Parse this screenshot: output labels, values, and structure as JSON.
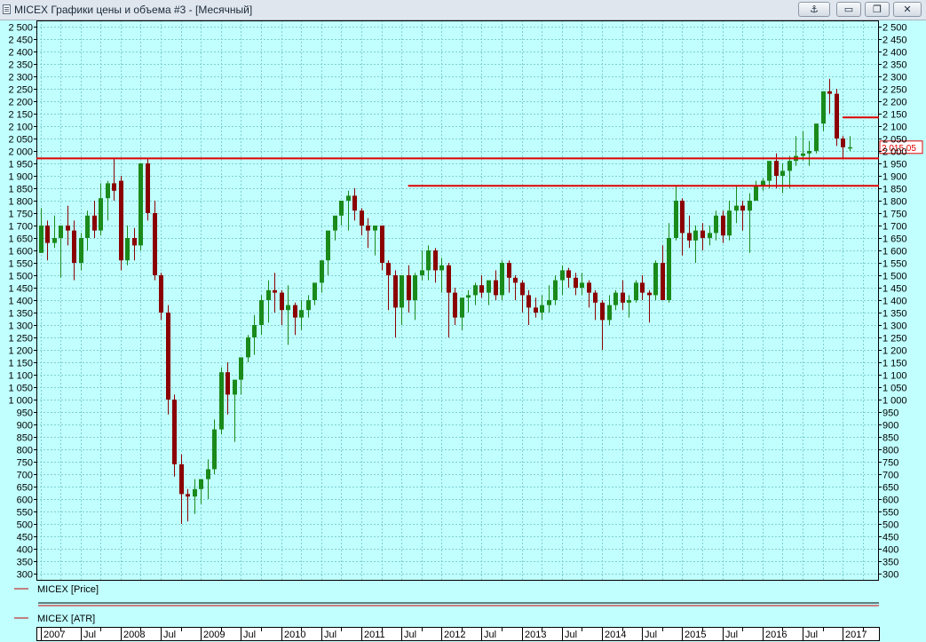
{
  "window": {
    "title": "MICEX Графики цены и объема #3 - [Месячный]",
    "icons": [
      "chart-window-icon",
      "anchor-icon",
      "minimize-icon",
      "restore-icon",
      "close-icon"
    ]
  },
  "legend": {
    "price_label": "MICEX [Price]",
    "atr_label": "MICEX [ATR]"
  },
  "colors": {
    "background": "#c1ffff",
    "grid": "#7fcfcf",
    "up_candle": "#1a8a1a",
    "down_candle": "#8b0000",
    "level_line": "#e00000",
    "axis_text": "#000000"
  },
  "chart_data": {
    "type": "candlestick",
    "instrument": "MICEX",
    "timeframe": "Месячный",
    "ylim": [
      275,
      2525
    ],
    "y_ticks": [
      2500,
      2450,
      2400,
      2350,
      2300,
      2250,
      2200,
      2150,
      2100,
      2050,
      2000,
      1950,
      1900,
      1850,
      1800,
      1750,
      1700,
      1650,
      1600,
      1550,
      1500,
      1450,
      1400,
      1350,
      1300,
      1250,
      1200,
      1150,
      1100,
      1050,
      1000,
      950,
      900,
      850,
      800,
      750,
      700,
      650,
      600,
      550,
      500,
      450,
      400,
      350,
      300
    ],
    "y_tick_labels": [
      "2 500",
      "2 450",
      "2 400",
      "2 350",
      "2 300",
      "2 250",
      "2 200",
      "2 150",
      "2 100",
      "2 050",
      "2 000",
      "1 950",
      "1 900",
      "1 850",
      "1 800",
      "1 750",
      "1 700",
      "1 650",
      "1 600",
      "1 550",
      "1 500",
      "1 450",
      "1 400",
      "1 350",
      "1 300",
      "1 250",
      "1 200",
      "1 150",
      "1 100",
      "1 050",
      "1 000",
      "950",
      "900",
      "850",
      "800",
      "750",
      "700",
      "650",
      "600",
      "550",
      "500",
      "450",
      "400",
      "350",
      "300"
    ],
    "x_labels": [
      {
        "label": "2007",
        "month": 0
      },
      {
        "label": "Jul",
        "month": 6
      },
      {
        "label": "2008",
        "month": 12
      },
      {
        "label": "Jul",
        "month": 18
      },
      {
        "label": "2009",
        "month": 24
      },
      {
        "label": "Jul",
        "month": 30
      },
      {
        "label": "2010",
        "month": 36
      },
      {
        "label": "Jul",
        "month": 42
      },
      {
        "label": "2011",
        "month": 48
      },
      {
        "label": "Jul",
        "month": 54
      },
      {
        "label": "2012",
        "month": 60
      },
      {
        "label": "Jul",
        "month": 66
      },
      {
        "label": "2013",
        "month": 72
      },
      {
        "label": "Jul",
        "month": 78
      },
      {
        "label": "2014",
        "month": 84
      },
      {
        "label": "Jul",
        "month": 90
      },
      {
        "label": "2015",
        "month": 96
      },
      {
        "label": "Jul",
        "month": 102
      },
      {
        "label": "2016",
        "month": 108
      },
      {
        "label": "Jul",
        "month": 114
      },
      {
        "label": "2017",
        "month": 120
      }
    ],
    "last_price_label": "2 015.05",
    "last_price": 2015,
    "levels": [
      {
        "value": 1970,
        "from_month": 0,
        "to_month": 127
      },
      {
        "value": 1860,
        "from_month": 55,
        "to_month": 127
      },
      {
        "value": 1860,
        "from_month": 55,
        "to_month": 56
      },
      {
        "value": 2135,
        "from_month": 120,
        "to_month": 127
      }
    ],
    "candles": [
      [
        1590,
        1770,
        1680,
        1700
      ],
      [
        1700,
        1720,
        1560,
        1630
      ],
      [
        1630,
        1740,
        1610,
        1650
      ],
      [
        1650,
        1700,
        1490,
        1700
      ],
      [
        1700,
        1780,
        1620,
        1680
      ],
      [
        1680,
        1720,
        1480,
        1550
      ],
      [
        1550,
        1670,
        1520,
        1650
      ],
      [
        1650,
        1760,
        1600,
        1740
      ],
      [
        1740,
        1800,
        1650,
        1680
      ],
      [
        1680,
        1870,
        1660,
        1810
      ],
      [
        1810,
        1880,
        1720,
        1870
      ],
      [
        1870,
        1970,
        1800,
        1840
      ],
      [
        1880,
        1900,
        1520,
        1560
      ],
      [
        1560,
        1700,
        1540,
        1650
      ],
      [
        1650,
        1690,
        1560,
        1620
      ],
      [
        1620,
        1940,
        1600,
        1950
      ],
      [
        1950,
        1970,
        1720,
        1750
      ],
      [
        1750,
        1800,
        1480,
        1500
      ],
      [
        1500,
        1510,
        1320,
        1350
      ],
      [
        1350,
        1380,
        940,
        1000
      ],
      [
        1000,
        1020,
        690,
        740
      ],
      [
        740,
        780,
        500,
        620
      ],
      [
        620,
        640,
        510,
        610
      ],
      [
        610,
        680,
        540,
        640
      ],
      [
        640,
        680,
        580,
        680
      ],
      [
        680,
        760,
        600,
        720
      ],
      [
        720,
        920,
        700,
        880
      ],
      [
        880,
        1130,
        860,
        1110
      ],
      [
        1110,
        1150,
        940,
        1020
      ],
      [
        1020,
        1060,
        830,
        1080
      ],
      [
        1080,
        1140,
        1020,
        1170
      ],
      [
        1170,
        1260,
        1150,
        1250
      ],
      [
        1250,
        1340,
        1180,
        1300
      ],
      [
        1300,
        1420,
        1260,
        1400
      ],
      [
        1400,
        1480,
        1310,
        1440
      ],
      [
        1440,
        1510,
        1350,
        1430
      ],
      [
        1430,
        1440,
        1300,
        1360
      ],
      [
        1360,
        1460,
        1220,
        1380
      ],
      [
        1380,
        1390,
        1260,
        1330
      ],
      [
        1330,
        1400,
        1280,
        1360
      ],
      [
        1360,
        1420,
        1330,
        1400
      ],
      [
        1400,
        1460,
        1380,
        1470
      ],
      [
        1470,
        1520,
        1430,
        1560
      ],
      [
        1560,
        1620,
        1500,
        1680
      ],
      [
        1680,
        1720,
        1640,
        1740
      ],
      [
        1740,
        1800,
        1700,
        1800
      ],
      [
        1800,
        1840,
        1680,
        1820
      ],
      [
        1820,
        1850,
        1720,
        1760
      ],
      [
        1760,
        1770,
        1660,
        1700
      ],
      [
        1700,
        1730,
        1610,
        1680
      ],
      [
        1680,
        1690,
        1580,
        1700
      ],
      [
        1700,
        1700,
        1520,
        1550
      ],
      [
        1550,
        1560,
        1360,
        1500
      ],
      [
        1500,
        1520,
        1250,
        1370
      ],
      [
        1370,
        1490,
        1300,
        1500
      ],
      [
        1500,
        1540,
        1350,
        1400
      ],
      [
        1400,
        1510,
        1320,
        1500
      ],
      [
        1500,
        1600,
        1480,
        1520
      ],
      [
        1520,
        1620,
        1480,
        1600
      ],
      [
        1600,
        1610,
        1470,
        1520
      ],
      [
        1520,
        1570,
        1430,
        1540
      ],
      [
        1540,
        1550,
        1250,
        1430
      ],
      [
        1430,
        1450,
        1300,
        1330
      ],
      [
        1330,
        1400,
        1280,
        1410
      ],
      [
        1410,
        1440,
        1350,
        1420
      ],
      [
        1420,
        1470,
        1380,
        1460
      ],
      [
        1460,
        1500,
        1410,
        1430
      ],
      [
        1430,
        1470,
        1380,
        1480
      ],
      [
        1480,
        1520,
        1400,
        1420
      ],
      [
        1420,
        1560,
        1400,
        1550
      ],
      [
        1550,
        1560,
        1430,
        1490
      ],
      [
        1490,
        1500,
        1400,
        1470
      ],
      [
        1470,
        1480,
        1350,
        1420
      ],
      [
        1420,
        1440,
        1300,
        1370
      ],
      [
        1370,
        1410,
        1330,
        1350
      ],
      [
        1350,
        1420,
        1320,
        1380
      ],
      [
        1380,
        1460,
        1350,
        1400
      ],
      [
        1400,
        1500,
        1380,
        1480
      ],
      [
        1480,
        1540,
        1420,
        1520
      ],
      [
        1520,
        1530,
        1450,
        1490
      ],
      [
        1490,
        1510,
        1420,
        1450
      ],
      [
        1450,
        1510,
        1420,
        1470
      ],
      [
        1470,
        1480,
        1370,
        1430
      ],
      [
        1430,
        1440,
        1320,
        1390
      ],
      [
        1390,
        1400,
        1200,
        1320
      ],
      [
        1320,
        1420,
        1300,
        1380
      ],
      [
        1380,
        1440,
        1360,
        1430
      ],
      [
        1430,
        1480,
        1360,
        1390
      ],
      [
        1390,
        1420,
        1330,
        1400
      ],
      [
        1400,
        1480,
        1390,
        1470
      ],
      [
        1470,
        1500,
        1400,
        1430
      ],
      [
        1430,
        1440,
        1310,
        1420
      ],
      [
        1420,
        1560,
        1400,
        1550
      ],
      [
        1550,
        1620,
        1430,
        1400
      ],
      [
        1400,
        1710,
        1390,
        1650
      ],
      [
        1650,
        1860,
        1640,
        1800
      ],
      [
        1800,
        1810,
        1580,
        1670
      ],
      [
        1670,
        1740,
        1610,
        1640
      ],
      [
        1640,
        1700,
        1550,
        1680
      ],
      [
        1680,
        1710,
        1600,
        1650
      ],
      [
        1650,
        1700,
        1620,
        1670
      ],
      [
        1670,
        1760,
        1640,
        1740
      ],
      [
        1740,
        1760,
        1630,
        1660
      ],
      [
        1660,
        1800,
        1640,
        1760
      ],
      [
        1760,
        1860,
        1710,
        1780
      ],
      [
        1780,
        1800,
        1680,
        1760
      ],
      [
        1760,
        1830,
        1590,
        1800
      ],
      [
        1800,
        1880,
        1800,
        1860
      ],
      [
        1860,
        1890,
        1840,
        1880
      ],
      [
        1880,
        1950,
        1850,
        1960
      ],
      [
        1960,
        1990,
        1850,
        1900
      ],
      [
        1900,
        1950,
        1830,
        1920
      ],
      [
        1920,
        1980,
        1850,
        1960
      ],
      [
        1960,
        2060,
        1940,
        1980
      ],
      [
        1980,
        2080,
        1960,
        1990
      ],
      [
        1990,
        2040,
        1940,
        2000
      ],
      [
        2000,
        2110,
        1990,
        2110
      ],
      [
        2110,
        2240,
        2080,
        2240
      ],
      [
        2240,
        2290,
        2150,
        2230
      ],
      [
        2230,
        2250,
        2020,
        2050
      ],
      [
        2050,
        2060,
        1970,
        2015
      ],
      [
        2015,
        2060,
        2000,
        2015
      ]
    ]
  }
}
